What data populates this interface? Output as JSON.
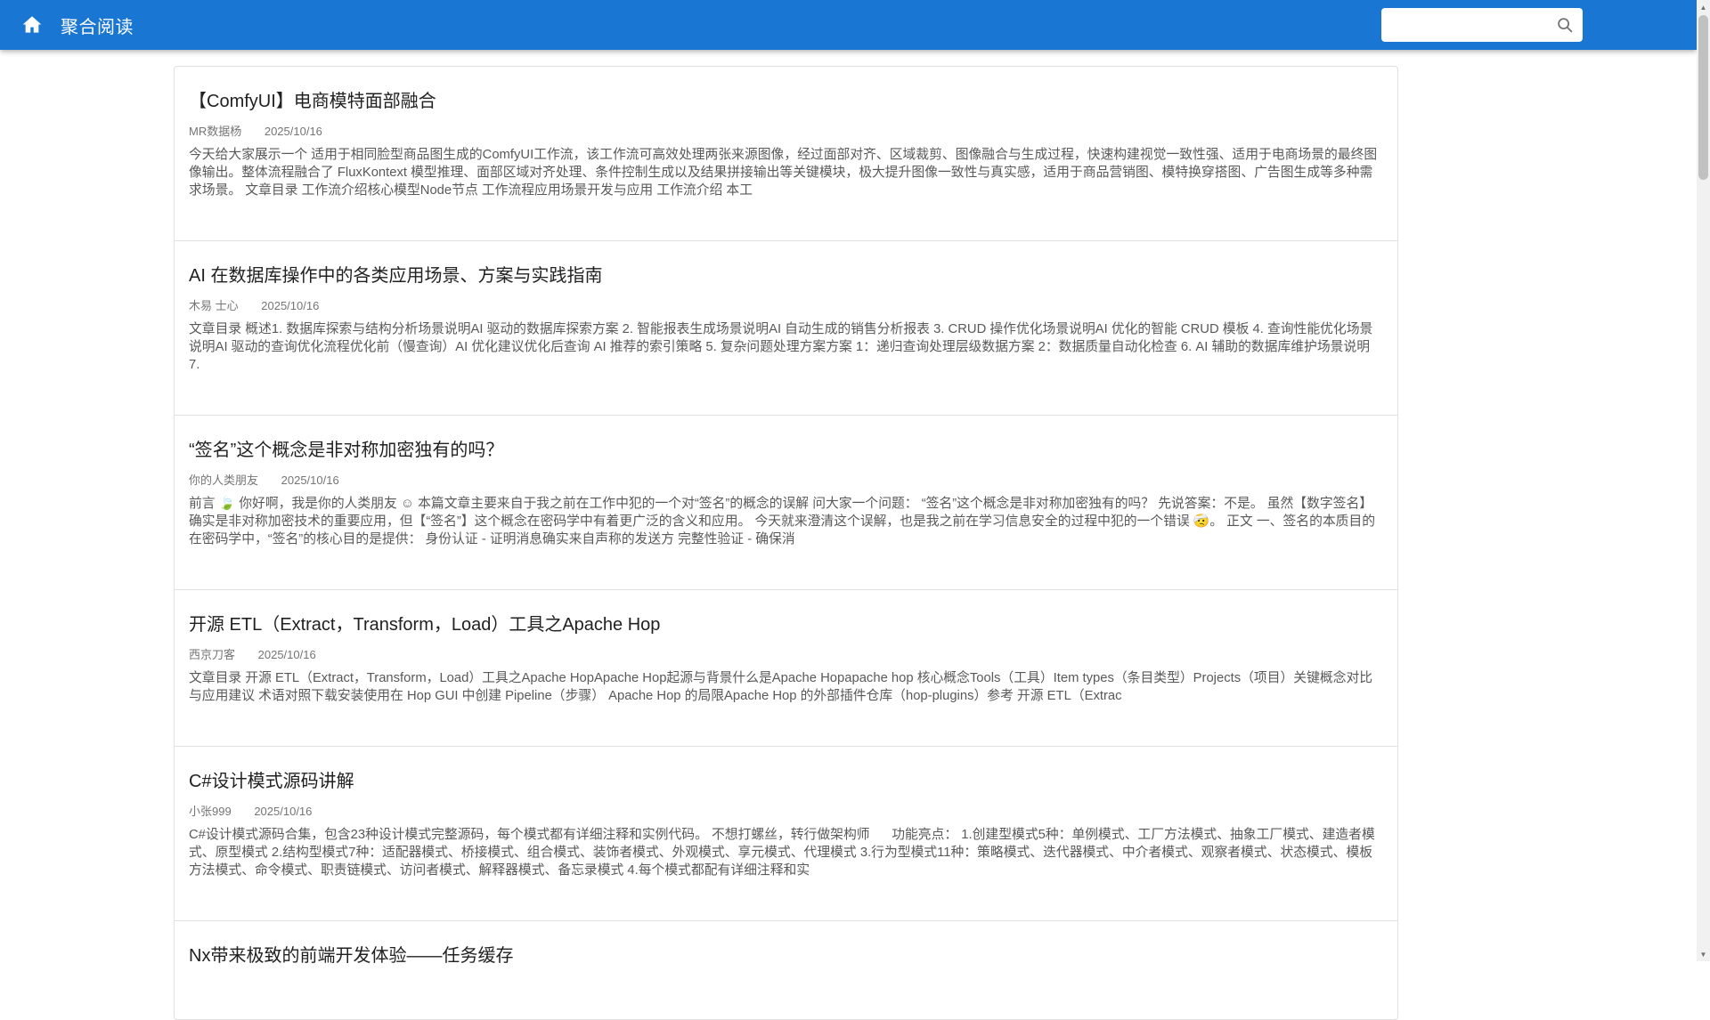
{
  "appbar": {
    "title": "聚合阅读",
    "color": "#1976d2",
    "home_icon": "house ⌂",
    "search": {
      "value": "",
      "placeholder": "",
      "icon": "magnifier 🔍"
    }
  },
  "articles": [
    {
      "title": "【ComfyUI】电商模特面部融合",
      "author": "MR数据杨",
      "date": "2025/10/16",
      "summary": "今天给大家展示一个 适用于相同脸型商品图生成的ComfyUI工作流，该工作流可高效处理两张来源图像，经过面部对齐、区域裁剪、图像融合与生成过程，快速构建视觉一致性强、适用于电商场景的最终图像输出。整体流程融合了 FluxKontext 模型推理、面部区域对齐处理、条件控制生成以及结果拼接输出等关键模块，极大提升图像一致性与真实感，适用于商品营销图、模特换穿搭图、广告图生成等多种需求场景。 文章目录 工作流介绍核心模型Node节点 工作流程应用场景开发与应用 工作流介绍 本工"
    },
    {
      "title": "AI 在数据库操作中的各类应用场景、方案与实践指南",
      "author": "木易 士心",
      "date": "2025/10/16",
      "summary": "文章目录 概述1. 数据库探索与结构分析场景说明AI 驱动的数据库探索方案 2. 智能报表生成场景说明AI 自动生成的销售分析报表 3. CRUD 操作优化场景说明AI 优化的智能 CRUD 模板 4. 查询性能优化场景说明AI 驱动的查询优化流程优化前（慢查询）AI 优化建议优化后查询 AI 推荐的索引策略 5. 复杂问题处理方案方案 1：递归查询处理层级数据方案 2：数据质量自动化检查 6. AI 辅助的数据库维护场景说明 7."
    },
    {
      "title": "“签名”这个概念是非对称加密独有的吗？",
      "author": "你的人类朋友",
      "date": "2025/10/16",
      "summary": "前言 🍃 你好啊，我是你的人类朋友 ☺ 本篇文章主要来自于我之前在工作中犯的一个对“签名”的概念的误解 问大家一个问题： “签名”这个概念是非对称加密独有的吗？ 先说答案：不是。 虽然【数字签名】确实是非对称加密技术的重要应用，但【“签名”】这个概念在密码学中有着更广泛的含义和应用。 今天就来澄清这个误解，也是我之前在学习信息安全的过程中犯的一个错误 🤕。 正文 一、签名的本质目的 在密码学中，“签名”的核心目的是提供： 身份认证 - 证明消息确实来自声称的发送方 完整性验证 - 确保消"
    },
    {
      "title": "开源 ETL（Extract，Transform，Load）工具之Apache Hop",
      "author": "西京刀客",
      "date": "2025/10/16",
      "summary": "文章目录 开源 ETL（Extract，Transform，Load）工具之Apache HopApache Hop起源与背景什么是Apache Hopapache hop 核心概念Tools（工具）Item types（条目类型）Projects（项目）关键概念对比与应用建议 术语对照下载安装使用在 Hop GUI 中创建 Pipeline（步骤） Apache Hop 的局限Apache Hop 的外部插件仓库（hop-plugins）参考 开源 ETL（Extrac"
    },
    {
      "title": "C#设计模式源码讲解",
      "author": "小张999",
      "date": "2025/10/16",
      "summary": "C#设计模式源码合集，包含23种设计模式完整源码，每个模式都有详细注释和实例代码。 不想打螺丝，转行做架构师      功能亮点： 1.创建型模式5种：单例模式、工厂方法模式、抽象工厂模式、建造者模式、原型模式 2.结构型模式7种：适配器模式、桥接模式、组合模式、装饰者模式、外观模式、享元模式、代理模式 3.行为型模式11种：策略模式、迭代器模式、中介者模式、观察者模式、状态模式、模板方法模式、命令模式、职责链模式、访问者模式、解释器模式、备忘录模式 4.每个模式都配有详细注释和实"
    },
    {
      "title": "Nx带来极致的前端开发体验——任务缓存"
    }
  ]
}
